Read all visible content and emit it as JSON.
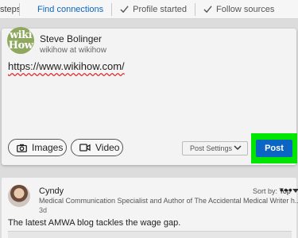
{
  "steps": {
    "label": "steps:",
    "items": [
      {
        "label": "Find connections",
        "state": "active"
      },
      {
        "label": "Profile started",
        "state": "done"
      },
      {
        "label": "Follow sources",
        "state": "done"
      }
    ]
  },
  "composer": {
    "avatar_text_1": "wiki",
    "avatar_text_2": "How",
    "author_name": "Steve Bolinger",
    "author_subtitle": "wikihow at wikihow",
    "post_text": "https://www.wikihow.com/",
    "images_label": "Images",
    "video_label": "Video",
    "post_settings_label": "Post Settings",
    "post_label": "Post"
  },
  "sort": {
    "prefix": "Sort by:",
    "value": "Top"
  },
  "feed": {
    "name": "Cyndy",
    "subtitle": "Medical Communication Specialist and Author of The Accidental Medical Writer h...",
    "time": "3d",
    "text": "The latest AMWA blog tackles the wage gap."
  },
  "colors": {
    "accent": "#0a66c2",
    "highlight": "#00e600"
  }
}
